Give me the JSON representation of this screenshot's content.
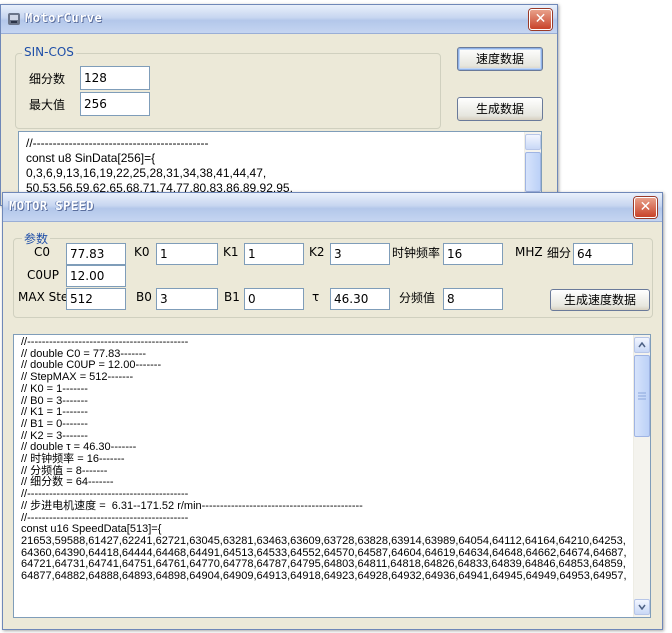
{
  "colors": {
    "accent": "#1f4fa8",
    "close": "#c8432a",
    "titlebar": "#c7d6f0"
  },
  "icons": {
    "app": "app-icon",
    "close": "close-icon",
    "scroll_up": "chevron-up-icon",
    "scroll_down": "chevron-down-icon"
  },
  "motorcurve": {
    "title": "MotorCurve",
    "close": "✕",
    "group_label": "SIN-COS",
    "subdiv_label": "细分数",
    "subdiv_value": "128",
    "max_label": "最大值",
    "max_value": "256",
    "speed_button": "速度数据",
    "gen_button": "生成数据",
    "output": "//--------------------------------------------\nconst u8 SinData[256]={\n0,3,6,9,13,16,19,22,25,28,31,34,38,41,44,47,\n50,53,56,59,62,65,68,71,74,77,80,83,86,89,92,95,"
  },
  "motorspeed": {
    "title": "MOTOR SPEED",
    "close": "✕",
    "group_label": "参数",
    "fields": {
      "c0_label": "C0",
      "c0_value": "77.83",
      "coup_label": "C0UP",
      "coup_value": "12.00",
      "maxstep_label": "MAX Step",
      "maxstep_value": "512",
      "k0_label": "K0",
      "k0_value": "1",
      "k1_label": "K1",
      "k1_value": "1",
      "k2_label": "K2",
      "k2_value": "3",
      "b0_label": "B0",
      "b0_value": "3",
      "b1_label": "B1",
      "b1_value": "0",
      "tau_label": "τ",
      "tau_value": "46.30",
      "clock_label": "时钟频率",
      "clock_value": "16",
      "clock_unit": "MHZ",
      "subdiv_label": "细分",
      "subdiv_value": "64",
      "divider_label": "分频值",
      "divider_value": "8"
    },
    "gen_button": "生成速度数据",
    "output": "//--------------------------------------------\n// double C0 = 77.83-------\n// double C0UP = 12.00-------\n// StepMAX = 512-------\n// K0 = 1-------\n// B0 = 3-------\n// K1 = 1-------\n// B1 = 0-------\n// K2 = 3-------\n// double τ = 46.30-------\n// 时钟频率 = 16-------\n// 分频值 = 8-------\n// 细分数 = 64-------\n//--------------------------------------------\n// 步进电机速度 =  6.31--171.52 r/min--------------------------------------------\n//--------------------------------------------\nconst u16 SpeedData[513]={\n21653,59588,61427,62241,62721,63045,63281,63463,63609,63728,63828,63914,63989,64054,64112,64164,64210,64253,\n64360,64390,64418,64444,64468,64491,64513,64533,64552,64570,64587,64604,64619,64634,64648,64662,64674,64687,\n64721,64731,64741,64751,64761,64770,64778,64787,64795,64803,64811,64818,64826,64833,64839,64846,64853,64859,\n64877,64882,64888,64893,64898,64904,64909,64913,64918,64923,64928,64932,64936,64941,64945,64949,64953,64957,"
  }
}
